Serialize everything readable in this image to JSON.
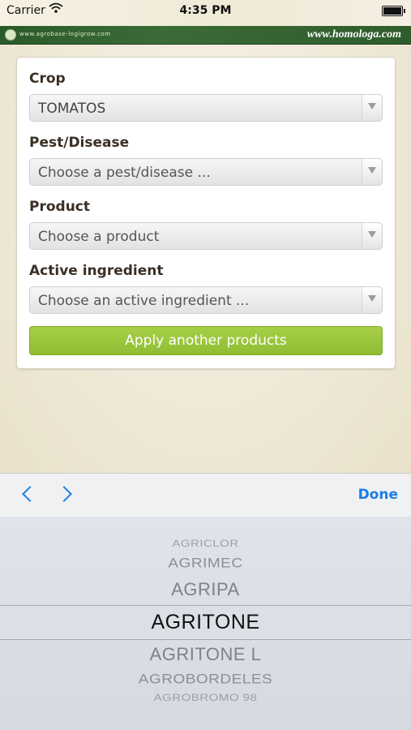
{
  "status_bar": {
    "carrier": "Carrier",
    "time": "4:35 PM"
  },
  "brand_band": {
    "small_url": "www.agrobase-logigrow.com",
    "brand": "www.homologa.com"
  },
  "form": {
    "crop": {
      "label": "Crop",
      "value": "TOMATOS"
    },
    "pest": {
      "label": "Pest/Disease",
      "placeholder": "Choose a pest/disease ..."
    },
    "product": {
      "label": "Product",
      "placeholder": "Choose a product"
    },
    "ingredient": {
      "label": "Active ingredient",
      "placeholder": "Choose an active ingredient ..."
    },
    "apply_label": "Apply another products"
  },
  "toolbar": {
    "prev_icon": "chevron-left-icon",
    "next_icon": "chevron-right-icon",
    "done_label": "Done"
  },
  "picker": {
    "items": [
      "AGRICLOR",
      "AGRIMEC",
      "AGRIPA",
      "AGRITONE",
      "AGRITONE L",
      "AGROBORDELES",
      "AGROBROMO 98"
    ],
    "selected": "AGRITONE"
  },
  "colors": {
    "brand_green": "#2e5c2b",
    "accent_blue": "#1b7ee6",
    "button_green": "#9bc63c"
  }
}
